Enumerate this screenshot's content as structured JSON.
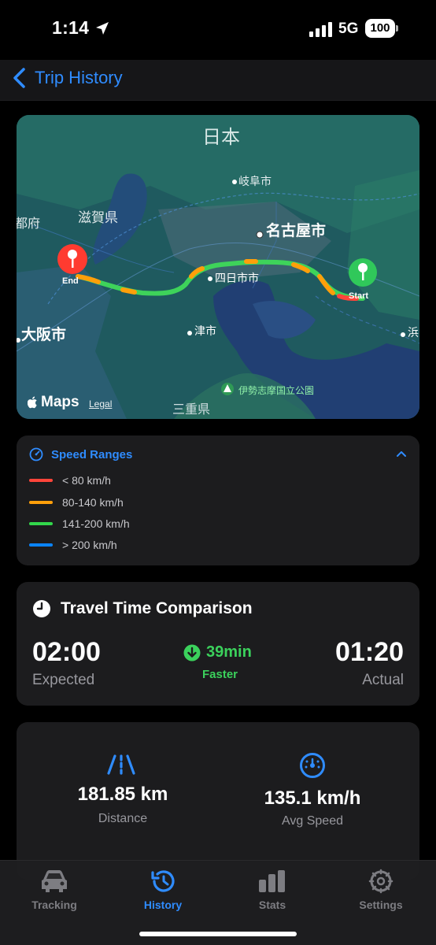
{
  "status_bar": {
    "time": "1:14",
    "network": "5G",
    "battery": "100"
  },
  "nav": {
    "back_label": "Trip History"
  },
  "map": {
    "labels": {
      "country": "日本",
      "gifu": "岐阜市",
      "shiga": "滋賀県",
      "fu": "都府",
      "nagoya": "名古屋市",
      "yokkaichi": "四日市市",
      "osaka": "大阪市",
      "tsu": "津市",
      "hama": "浜",
      "mie": "三重県",
      "park": "伊勢志摩国立公園"
    },
    "start_label": "Start",
    "end_label": "End",
    "brand": "Maps",
    "legal": "Legal"
  },
  "speed_ranges": {
    "title": "Speed Ranges",
    "items": [
      {
        "label": "< 80 km/h",
        "color": "#ff453a"
      },
      {
        "label": "80-140 km/h",
        "color": "#ff9f0a"
      },
      {
        "label": "141-200 km/h",
        "color": "#32d74b"
      },
      {
        "label": "> 200 km/h",
        "color": "#0a84ff"
      }
    ]
  },
  "travel_time": {
    "title": "Travel Time Comparison",
    "expected_value": "02:00",
    "expected_label": "Expected",
    "difference": "39min",
    "difference_label": "Faster",
    "actual_value": "01:20",
    "actual_label": "Actual"
  },
  "stats": {
    "distance_value": "181.85 km",
    "distance_label": "Distance",
    "speed_value": "135.1 km/h",
    "speed_label": "Avg Speed"
  },
  "tabs": [
    {
      "label": "Tracking",
      "icon": "car-icon"
    },
    {
      "label": "History",
      "icon": "history-icon"
    },
    {
      "label": "Stats",
      "icon": "bar-chart-icon"
    },
    {
      "label": "Settings",
      "icon": "gear-icon"
    }
  ],
  "colors": {
    "accent": "#2f8cff",
    "success": "#3bd15c",
    "background": "#000000",
    "card": "#1c1c1e"
  }
}
